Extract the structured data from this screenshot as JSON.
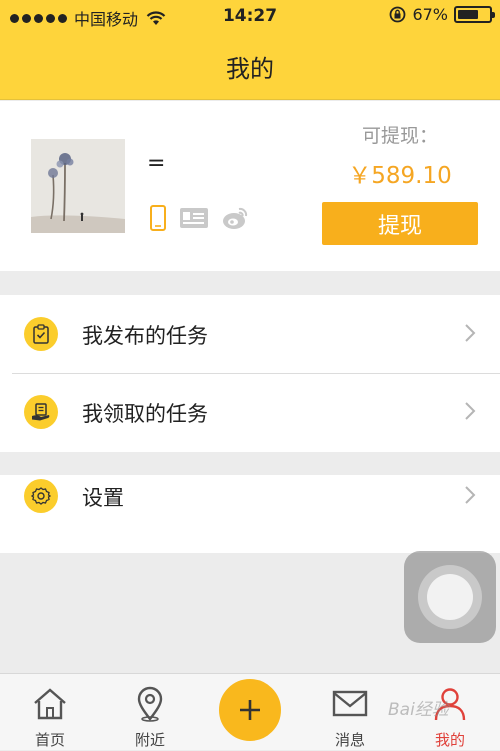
{
  "status_bar": {
    "carrier": "中国移动",
    "time": "14:27",
    "battery_percent": "67%",
    "battery_level": 0.67
  },
  "nav": {
    "title": "我的"
  },
  "profile": {
    "username": "=",
    "balance_label": "可提现：",
    "balance_value": "￥589.10",
    "withdraw_label": "提现",
    "verify_icons": [
      "phone-verified-icon",
      "id-card-icon",
      "weibo-icon"
    ]
  },
  "menu": {
    "published_tasks": "我发布的任务",
    "claimed_tasks": "我领取的任务",
    "settings": "设置"
  },
  "tabbar": {
    "home": "首页",
    "nearby": "附近",
    "messages": "消息",
    "mine": "我的",
    "active_color": "#e0413a"
  },
  "watermark": "Bai经验"
}
